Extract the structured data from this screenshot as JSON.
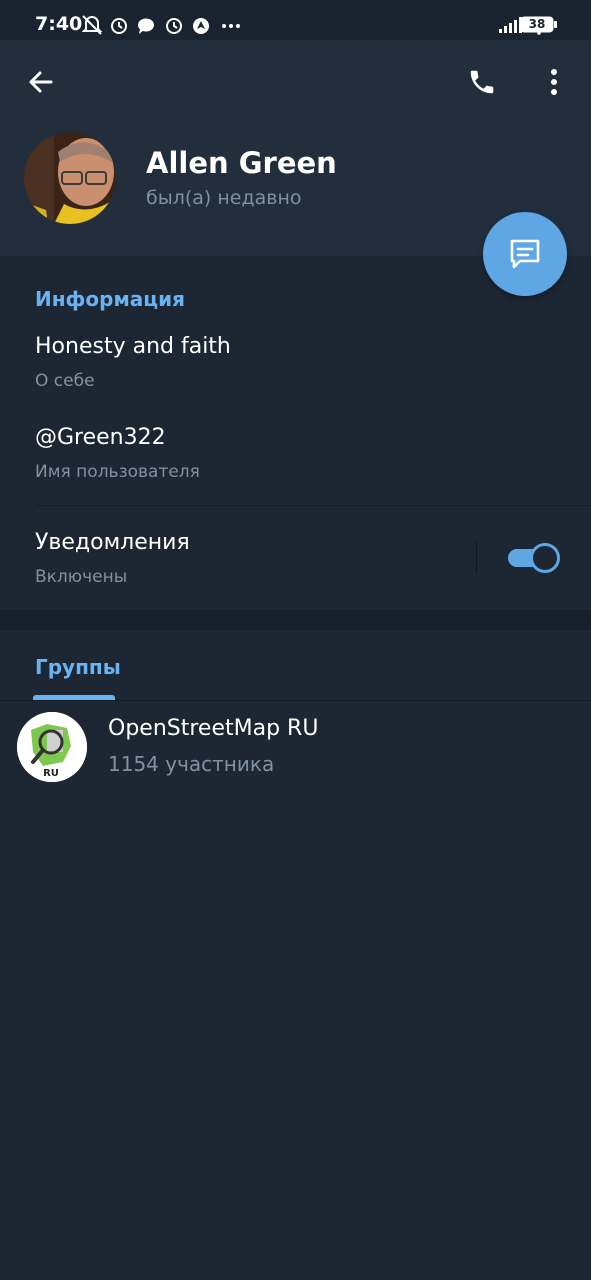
{
  "status_bar": {
    "time": "7:40",
    "battery": "38",
    "left_icons": [
      "muted-bell-icon",
      "alarm-icon",
      "message-bubble-icon",
      "alarm-icon",
      "location-icon",
      "more-dots-icon"
    ],
    "right_icons": [
      "signal-icon",
      "wifi-icon",
      "battery-icon"
    ]
  },
  "header": {
    "back_icon": "arrow-left-icon",
    "call_icon": "phone-icon",
    "menu_icon": "more-vertical-icon"
  },
  "profile": {
    "name": "Allen Green",
    "last_seen": "был(а) недавно",
    "message_button_icon": "message-icon"
  },
  "info": {
    "title": "Информация",
    "bio": {
      "value": "Honesty and faith",
      "label": "О себе"
    },
    "username": {
      "value": "@Green322",
      "label": "Имя пользователя"
    },
    "notifications": {
      "value": "Уведомления",
      "label": "Включены",
      "enabled": true
    }
  },
  "groups": {
    "tab_label": "Группы",
    "items": [
      {
        "name": "OpenStreetMap RU",
        "members": "1154 участника",
        "avatar_badge": "RU"
      }
    ]
  },
  "colors": {
    "accent": "#6ab3f3",
    "fab": "#5fa6e5",
    "header_bg": "#222e3c",
    "body_bg": "#1d2733",
    "secondary_text": "#7f91a4"
  }
}
